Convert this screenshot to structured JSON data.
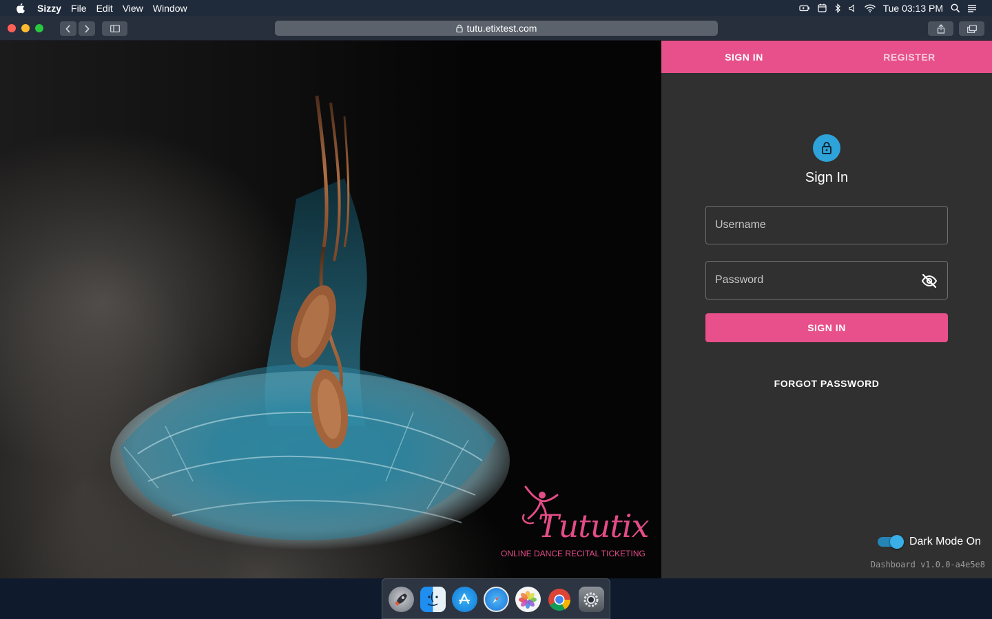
{
  "menubar": {
    "app_name": "Sizzy",
    "menus": [
      "File",
      "Edit",
      "View",
      "Window"
    ],
    "clock": "Tue 03:13 PM",
    "status_icons": [
      "battery-icon",
      "calendar-icon",
      "bluetooth-icon",
      "volume-icon",
      "wifi-icon",
      "spotlight-icon",
      "notification-center-icon"
    ]
  },
  "browser": {
    "url": "tutu.etixtest.com"
  },
  "hero": {
    "brand_name": "Tututix",
    "tagline": "ONLINE DANCE RECITAL TICKETING",
    "brand_color": "#e24c87"
  },
  "auth": {
    "tabs": [
      {
        "label": "SIGN IN",
        "active": true
      },
      {
        "label": "REGISTER",
        "active": false
      }
    ],
    "title": "Sign In",
    "username_placeholder": "Username",
    "password_placeholder": "Password",
    "submit_label": "SIGN IN",
    "forgot_label": "FORGOT PASSWORD",
    "accent_color": "#e7508a",
    "lock_color": "#2ea3d9"
  },
  "footer": {
    "dark_mode_label": "Dark Mode On",
    "dark_mode_enabled": true,
    "version": "Dashboard v1.0.0-a4e5e8"
  },
  "dock": {
    "apps": [
      "launchpad-icon",
      "finder-icon",
      "app-store-icon",
      "safari-icon",
      "photos-icon",
      "chrome-icon",
      "system-preferences-icon"
    ]
  }
}
